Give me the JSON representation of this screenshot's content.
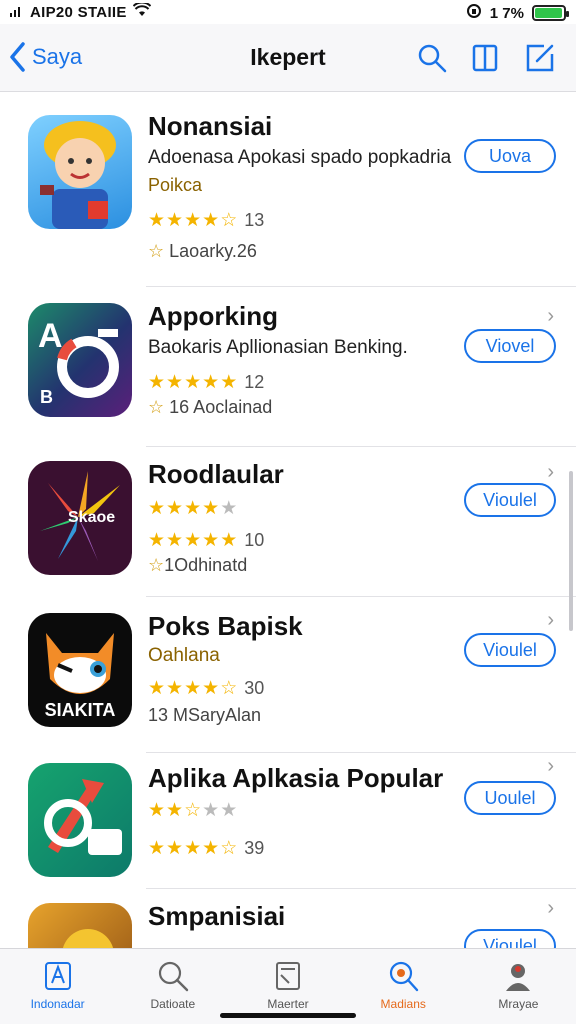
{
  "status": {
    "carrier": "AIP20 STAIIE",
    "battery_text": "1 7%",
    "battery_level": 0.95
  },
  "nav": {
    "back_label": "Saya",
    "title": "Ikepert"
  },
  "apps": [
    {
      "name": "Nonansiai",
      "subtitle": "Adoenasa Apokasi spado popkadria",
      "category": "Poikca",
      "rating": 4.5,
      "rating_count": "13",
      "meta": "Laoarky.26",
      "button": "Uova"
    },
    {
      "name": "Apporking",
      "subtitle": "Baokaris Apllionasian Benking.",
      "rating": 5,
      "rating_count": "12",
      "meta": "16 Aoclainad",
      "button": "Viovel"
    },
    {
      "name": "Roodlaular",
      "rating_a": 4,
      "rating": 5,
      "rating_count": "10",
      "meta": "1Odhinatd",
      "button": "Vioulel",
      "icon_text": "Skaoe"
    },
    {
      "name": "Poks Bapisk",
      "subtitle": "Oahlana",
      "rating": 4.5,
      "rating_count": "30",
      "meta": "13 MSaryAlan",
      "button": "Vioulel",
      "icon_text": "SIAKITA"
    },
    {
      "name": "Aplika Aplkasia Popular",
      "rating_a": 2.5,
      "rating": 4.5,
      "rating_count": "39",
      "button": "Uoulel"
    },
    {
      "name": "Smpanisiai",
      "button": "Vioulel"
    }
  ],
  "tabs": [
    {
      "label": "Indonadar",
      "icon": "today-icon"
    },
    {
      "label": "Datioate",
      "icon": "search-icon"
    },
    {
      "label": "Maerter",
      "icon": "apps-icon"
    },
    {
      "label": "Madians",
      "icon": "updates-icon"
    },
    {
      "label": "Mrayae",
      "icon": "account-icon"
    }
  ],
  "colors": {
    "accent": "#1a73e8",
    "star": "#f4b400",
    "battery": "#30c54a"
  }
}
